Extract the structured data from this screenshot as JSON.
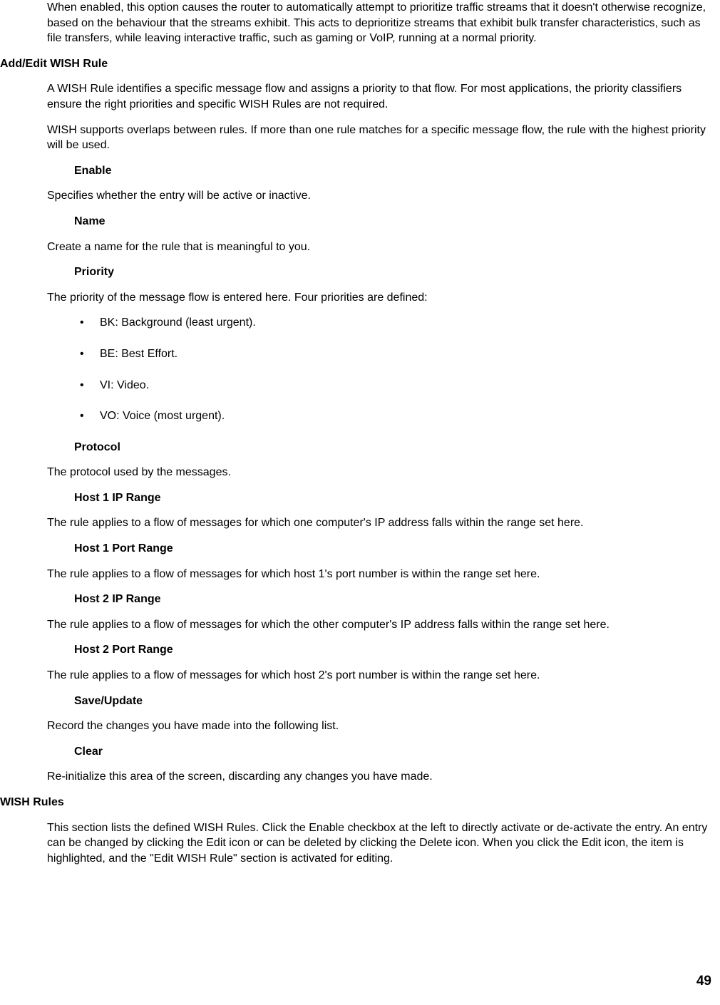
{
  "intro_paragraph": "When enabled, this option causes the router to automatically attempt to prioritize traffic streams that it doesn't otherwise recognize, based on the behaviour that the streams exhibit. This acts to deprioritize streams that exhibit bulk transfer characteristics, such as file transfers, while leaving interactive traffic, such as gaming or VoIP, running at a normal priority.",
  "section1": {
    "heading": "Add/Edit WISH Rule",
    "p1": "A WISH Rule identifies a specific message flow and assigns a priority to that flow. For most applications, the priority classifiers ensure the right priorities and specific WISH Rules are not required.",
    "p2": "WISH supports overlaps between rules. If more than one rule matches for a specific message flow, the rule with the highest priority will be used.",
    "enable": {
      "label": "Enable",
      "desc": "Specifies whether the entry will be active or inactive."
    },
    "name": {
      "label": "Name",
      "desc": "Create a name for the rule that is meaningful to you."
    },
    "priority": {
      "label": "Priority",
      "desc": "The priority of the message flow is entered here. Four priorities are defined:",
      "items": [
        "BK: Background (least urgent).",
        "BE: Best Effort.",
        "VI: Video.",
        "VO: Voice (most urgent)."
      ]
    },
    "protocol": {
      "label": "Protocol",
      "desc": "The protocol used by the messages."
    },
    "host1ip": {
      "label": "Host 1 IP Range",
      "desc": "The rule applies to a flow of messages for which one computer's IP address falls within the range set here."
    },
    "host1port": {
      "label": "Host 1 Port Range",
      "desc": "The rule applies to a flow of messages for which host 1's port number is within the range set here."
    },
    "host2ip": {
      "label": "Host 2 IP Range",
      "desc": "The rule applies to a flow of messages for which the other computer's IP address falls within the range set here."
    },
    "host2port": {
      "label": "Host 2 Port Range",
      "desc": "The rule applies to a flow of messages for which host 2's port number is within the range set here."
    },
    "save": {
      "label": "Save/Update",
      "desc": "Record the changes you have made into the following list."
    },
    "clear": {
      "label": "Clear",
      "desc": "Re-initialize this area of the screen, discarding any changes you have made."
    }
  },
  "section2": {
    "heading": "WISH Rules",
    "p1": "This section lists the defined WISH Rules. Click the Enable checkbox at the left to directly activate or de-activate the entry. An entry can be changed by clicking the Edit icon or can be deleted by clicking the Delete icon. When you click the Edit icon, the item is highlighted, and the \"Edit WISH Rule\" section is activated for editing."
  },
  "page_number": "49"
}
